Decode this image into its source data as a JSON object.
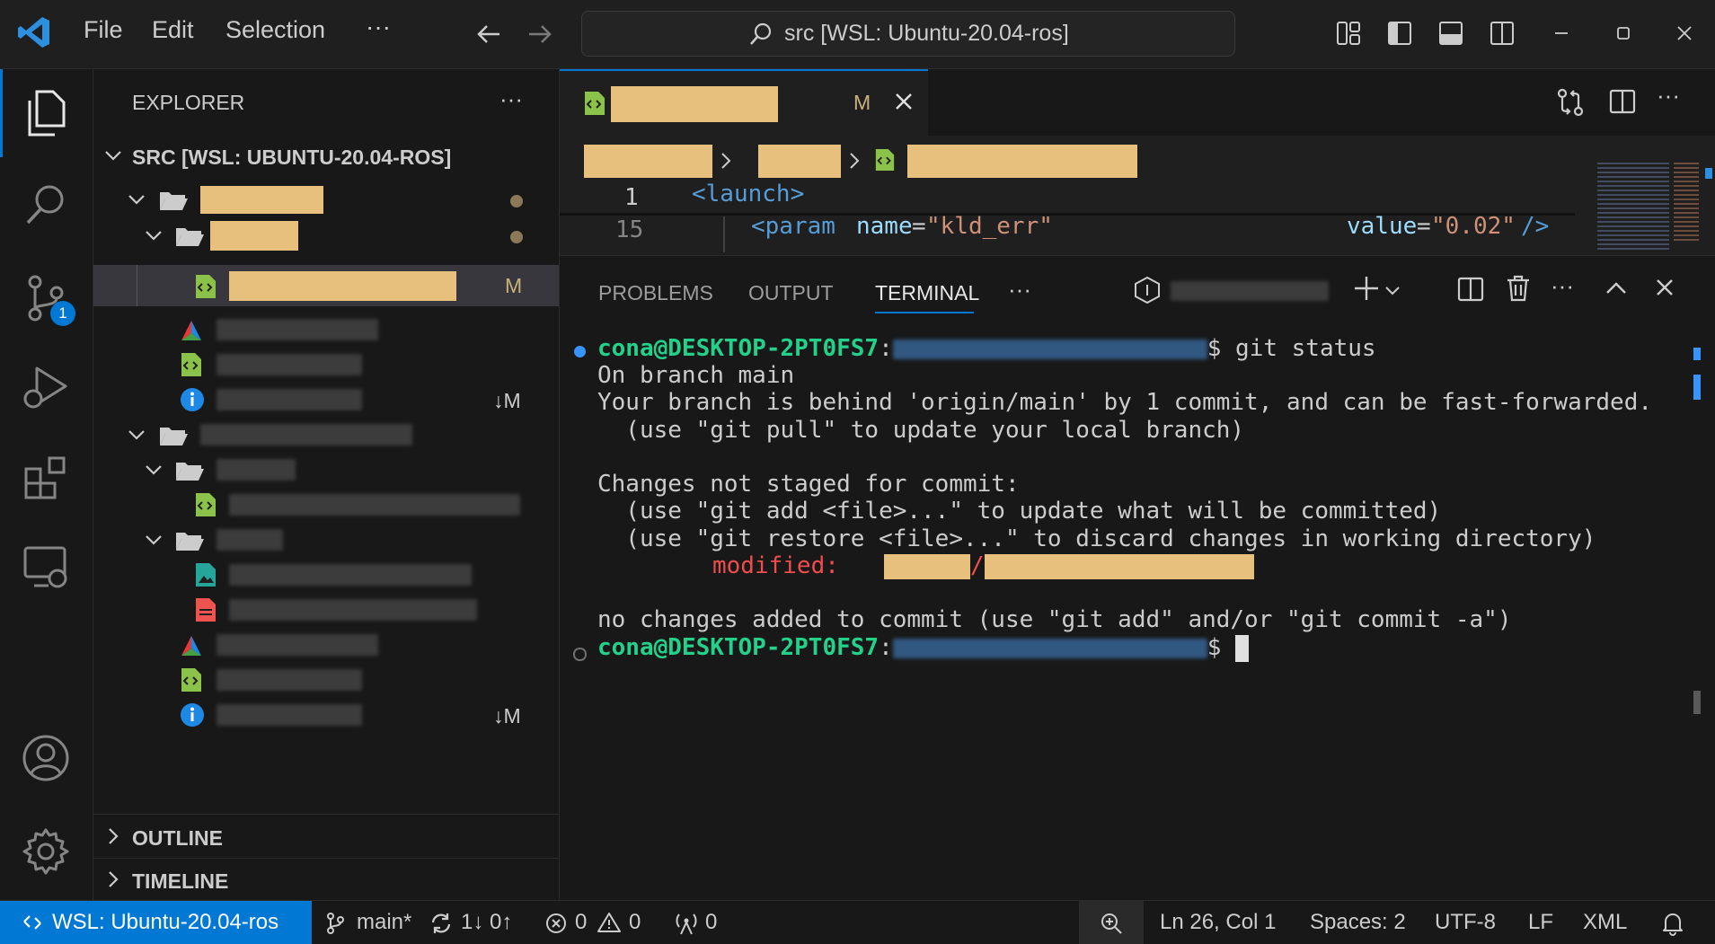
{
  "titlebar": {
    "menu": [
      "File",
      "Edit",
      "Selection"
    ],
    "more": "···",
    "command_center": "src [WSL: Ubuntu-20.04-ros]",
    "window_controls": [
      "minimize-icon",
      "maximize-icon",
      "close-icon"
    ]
  },
  "activity": {
    "scm_badge": "1"
  },
  "explorer": {
    "title": "EXPLORER",
    "more": "···",
    "root": "SRC [WSL: UBUNTU-20.04-ROS]",
    "modified_badge": "M",
    "down_modified_badge": "↓M",
    "outline": "OUTLINE",
    "timeline": "TIMELINE"
  },
  "editor": {
    "tab_badge": "M",
    "code_line1_no": "1",
    "code_line1": "<launch>",
    "code_line2_no": "15",
    "code_line2_tag": "<param",
    "code_line2_attr": "name",
    "code_line2_val": "\"kld_err\"",
    "code_line2_attr2": "value",
    "code_line2_val2": "\"0.02\"",
    "code_line2_end": "/>"
  },
  "panel": {
    "tabs": [
      "PROBLEMS",
      "OUTPUT",
      "TERMINAL"
    ],
    "active_tab": "TERMINAL",
    "more": "···",
    "terminal": {
      "prompt_user": "cona@DESKTOP-2PT0FS7",
      "prompt_colon": ":",
      "prompt_end": "$",
      "command": " git status",
      "lines": [
        "On branch main",
        "Your branch is behind 'origin/main' by 1 commit, and can be fast-forwarded.",
        "  (use \"git pull\" to update your local branch)",
        "",
        "Changes not staged for commit:",
        "  (use \"git add <file>...\" to update what will be committed)",
        "  (use \"git restore <file>...\" to discard changes in working directory)"
      ],
      "modified_label": "modified:",
      "modified_sep": "/",
      "footer": "no changes added to commit (use \"git add\" and/or \"git commit -a\")"
    }
  },
  "statusbar": {
    "remote": "WSL: Ubuntu-20.04-ros",
    "branch": "main*",
    "sync": "1↓ 0↑",
    "errors": "0",
    "warnings": "0",
    "ports": "0",
    "position": "Ln 26, Col 1",
    "spaces": "Spaces: 2",
    "encoding": "UTF-8",
    "eol": "LF",
    "language": "XML"
  },
  "colors": {
    "accent": "#0078d4",
    "redaction": "#e8c07d",
    "prompt_green": "#23d18b",
    "modified_red": "#f14c4c",
    "file_green": "#8bc34a"
  }
}
